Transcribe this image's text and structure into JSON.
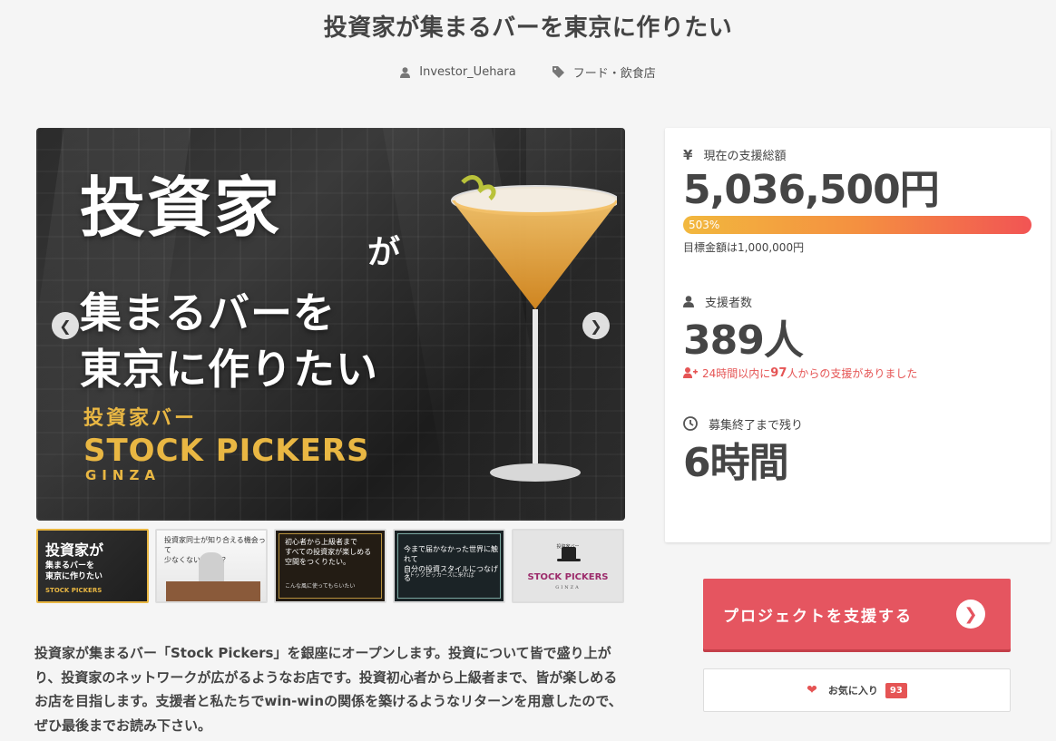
{
  "page": {
    "title": "投資家が集まるバーを東京に作りたい",
    "author": "Investor_Uehara",
    "category": "フード・飲食店"
  },
  "hero": {
    "big_text": "投資家",
    "ga": "が",
    "line2": "集まるバーを",
    "line3": "東京に作りたい",
    "sub": "投資家バー",
    "brand": "STOCK PICKERS",
    "ginza": "GINZA",
    "prev_icon": "chevron-left-icon",
    "next_icon": "chevron-right-icon"
  },
  "thumbnails": [
    {
      "title": "投資家が",
      "sub": "集まるバーを\n東京に作りたい",
      "brand": "STOCK PICKERS"
    },
    {
      "sub": "投資家同士が知り合える機会って\n少なくないですか？"
    },
    {
      "sub": "初心者から上級者まで\nすべての投資家が楽しめる\n空間をつくりたい。",
      "sub2": "こんな風に使ってもらいたい"
    },
    {
      "sub": "今まで届かなかった世界に触れて\n自分の投資スタイルにつなげる",
      "sub2": "ストックピッカーズに来れば"
    },
    {
      "top": "投資家バー",
      "brand": "STOCK PICKERS",
      "ginza": "GINZA"
    }
  ],
  "description": "投資家が集まるバー「Stock Pickers」を銀座にオープンします。投資について皆で盛り上がり、投資家のネットワークが広がるようなお店です。投資初心者から上級者まで、皆が楽しめるお店を目指します。支援者と私たちでwin-winの関係を築けるようなリターンを用意したので、ぜひ最後までお読み下さい。",
  "stats": {
    "total_label": "現在の支援総額",
    "total_value": "5,036,500円",
    "progress_percent": 503,
    "progress_label": "503%",
    "goal_text": "目標金額は1,000,000円",
    "supporters_label": "支援者数",
    "supporters_value": "389人",
    "recent_pre": "24時間以内に",
    "recent_count": "97",
    "recent_post": "人からの支援がありました",
    "remaining_label": "募集終了まで残り",
    "remaining_value": "6時間"
  },
  "actions": {
    "support_label": "プロジェクトを支援する",
    "favorite_label": "お気に入り",
    "favorite_count": "93"
  },
  "colors": {
    "accent": "#e55560",
    "gold": "#e9b743",
    "progress_start": "#f2b83e",
    "progress_end": "#f25454"
  }
}
